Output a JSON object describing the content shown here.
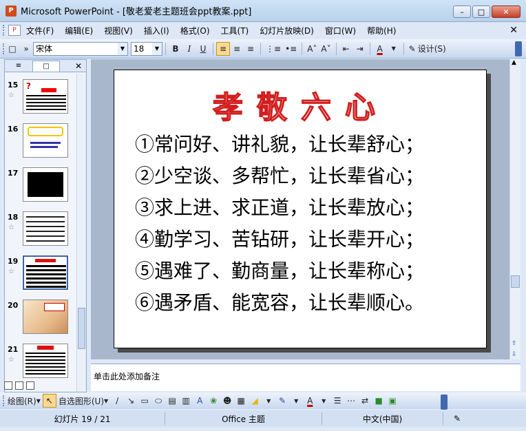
{
  "window": {
    "title": "Microsoft PowerPoint - [敬老爱老主题班会ppt教案.ppt]"
  },
  "menu": [
    "文件(F)",
    "编辑(E)",
    "视图(V)",
    "插入(I)",
    "格式(O)",
    "工具(T)",
    "幻灯片放映(D)",
    "窗口(W)",
    "帮助(H)"
  ],
  "toolbar": {
    "font": "宋体",
    "size": "18",
    "bold": "B",
    "italic": "I",
    "underline": "U",
    "design": "设计(S)"
  },
  "thumbnails": [
    {
      "num": "15",
      "star": "☆"
    },
    {
      "num": "16",
      "star": ""
    },
    {
      "num": "17",
      "star": ""
    },
    {
      "num": "18",
      "star": "☆"
    },
    {
      "num": "19",
      "star": "☆"
    },
    {
      "num": "20",
      "star": ""
    },
    {
      "num": "21",
      "star": "☆"
    }
  ],
  "slide": {
    "title": "孝敬六心",
    "lines": [
      "①常问好、讲礼貌，让长辈舒心；",
      "②少空谈、多帮忙，让长辈省心；",
      "③求上进、求正道，让长辈放心；",
      "④勤学习、苦钻研，让长辈开心；",
      "⑤遇难了、勤商量，让长辈称心；",
      "⑥遇矛盾、能宽容，让长辈顺心。"
    ]
  },
  "notes": {
    "placeholder": "单击此处添加备注"
  },
  "drawing": {
    "draw": "绘图(R)",
    "autoshapes": "自选图形(U)"
  },
  "status": {
    "slide": "幻灯片 19 / 21",
    "design": "Office 主题",
    "lang": "中文(中国)"
  }
}
